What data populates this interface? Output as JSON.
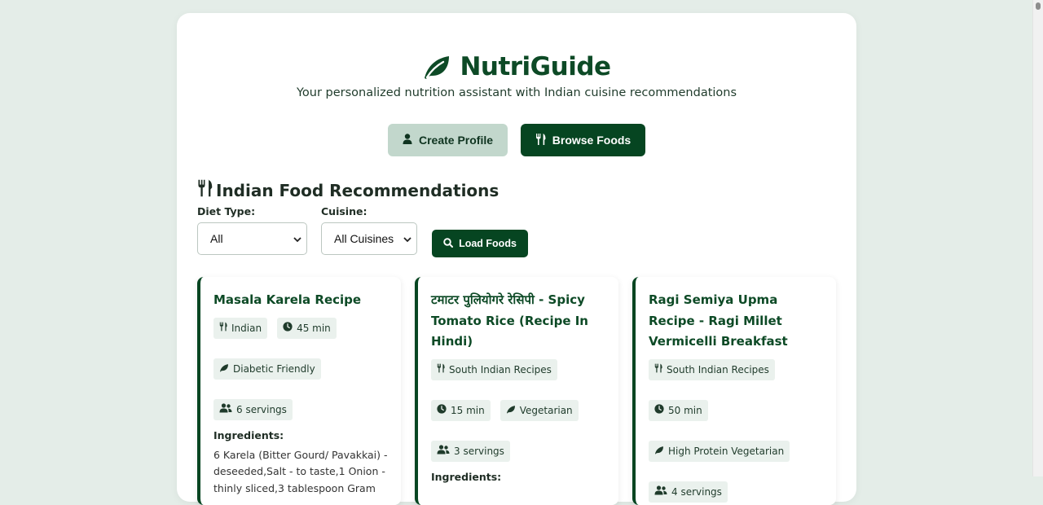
{
  "header": {
    "brand": "NutriGuide",
    "tagline": "Your personalized nutrition assistant with Indian cuisine recommendations"
  },
  "nav": {
    "create_profile": "Create Profile",
    "browse_foods": "Browse Foods"
  },
  "section": {
    "title": "Indian Food Recommendations"
  },
  "filters": {
    "diet_label": "Diet Type:",
    "diet_value": "All",
    "cuisine_label": "Cuisine:",
    "cuisine_value": "All Cuisines",
    "load_button": "Load Foods"
  },
  "foods": [
    {
      "title": "Masala Karela Recipe",
      "cuisine": "Indian",
      "time": "45 min",
      "diet": "Diabetic Friendly",
      "servings": "6 servings",
      "ingredients_label": "Ingredients:",
      "ingredients": "6 Karela (Bitter Gourd/ Pavakkai) - deseeded,Salt - to taste,1 Onion - thinly sliced,3 tablespoon Gram"
    },
    {
      "title": "टमाटर पुलियोगरे रेसिपी - Spicy Tomato Rice (Recipe In Hindi)",
      "cuisine": "South Indian Recipes",
      "time": "15 min",
      "diet": "Vegetarian",
      "servings": "3 servings",
      "ingredients_label": "Ingredients:",
      "ingredients": ""
    },
    {
      "title": "Ragi Semiya Upma Recipe - Ragi Millet Vermicelli Breakfast",
      "cuisine": "South Indian Recipes",
      "time": "50 min",
      "diet": "High Protein Vegetarian",
      "servings": "4 servings",
      "ingredients_label": "",
      "ingredients": ""
    }
  ],
  "colors": {
    "page_bg": "#e4ede8",
    "primary": "#064521",
    "secondary_button": "#c2d7cc",
    "tag_bg": "#eaf1ed"
  },
  "icons": {
    "brand": "leaf-icon",
    "profile": "user-icon",
    "browse": "utensils-icon",
    "search": "search-icon",
    "time": "clock-icon",
    "diet": "leaf-icon",
    "servings": "users-icon"
  }
}
